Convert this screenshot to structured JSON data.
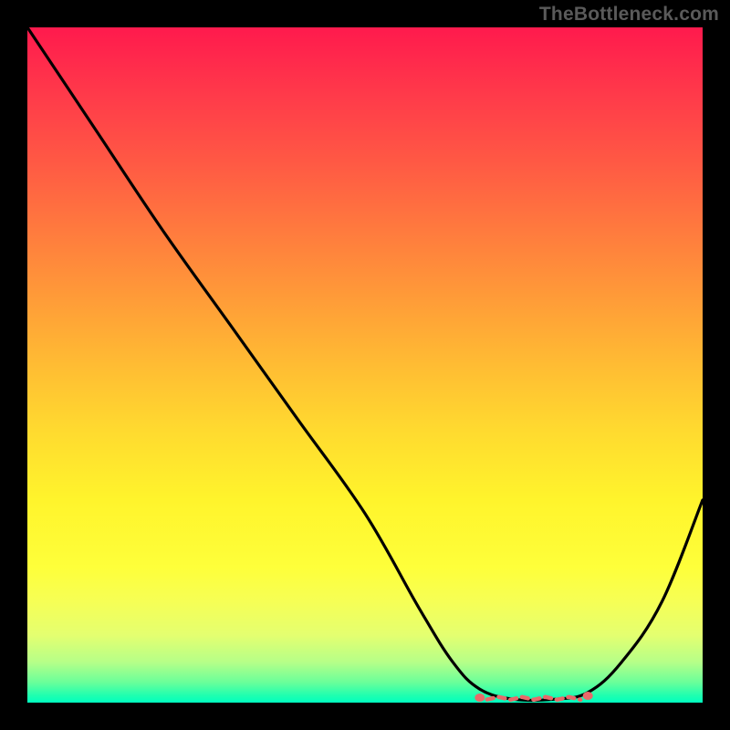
{
  "watermark": "TheBottleneck.com",
  "chart_data": {
    "type": "line",
    "title": "",
    "xlabel": "",
    "ylabel": "",
    "xlim": [
      0,
      100
    ],
    "ylim": [
      0,
      100
    ],
    "grid": false,
    "series": [
      {
        "name": "curve",
        "x": [
          0,
          10,
          20,
          30,
          40,
          50,
          58,
          63,
          67,
          72,
          78,
          83,
          88,
          94,
          100
        ],
        "values": [
          100,
          85,
          70,
          56,
          42,
          28,
          14,
          6,
          2,
          0.5,
          0.5,
          1.5,
          6,
          15,
          30
        ]
      }
    ],
    "annotations": {
      "optimal_range_x": [
        67,
        83
      ],
      "optimal_range_label": ""
    },
    "colors": {
      "gradient_top": "#ff1a4d",
      "gradient_bottom": "#00ffc0",
      "curve": "#000000",
      "marker": "#e86a6a"
    }
  }
}
